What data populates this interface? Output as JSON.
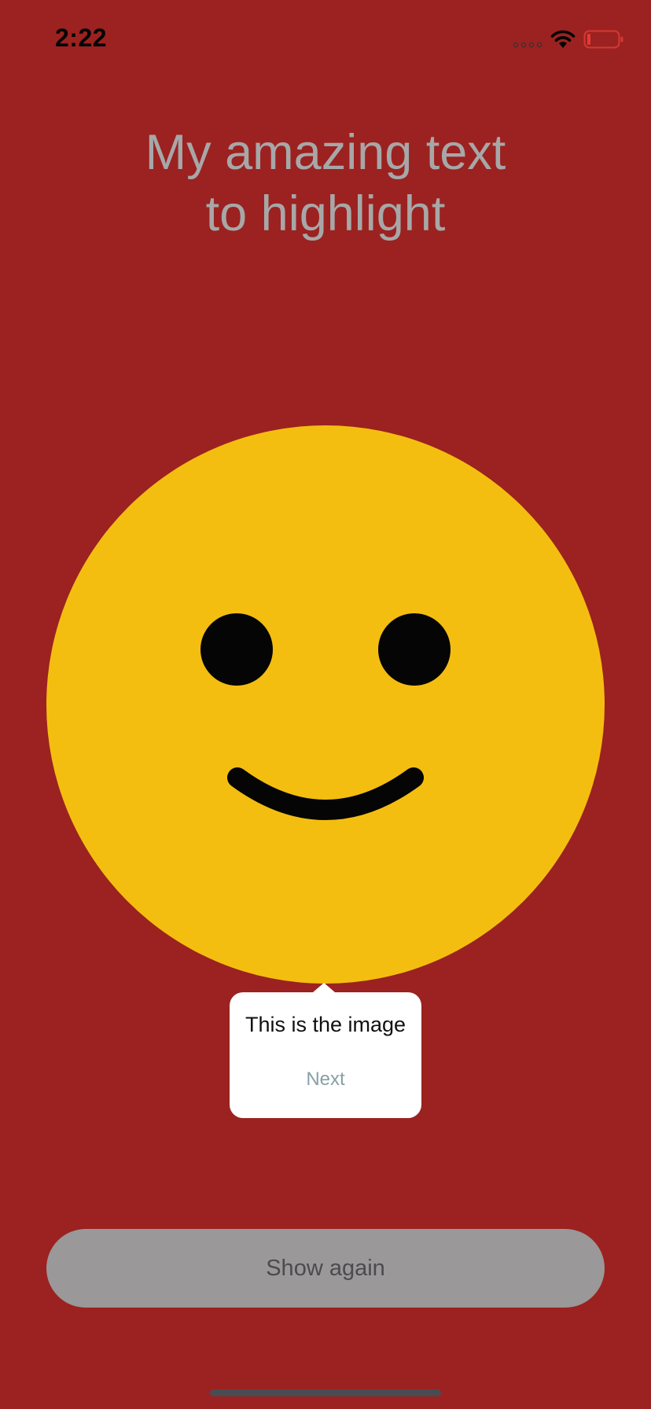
{
  "status_bar": {
    "time": "2:22",
    "icons": [
      "cellular-signal-icon",
      "wifi-icon",
      "battery-icon"
    ]
  },
  "main": {
    "headline_line1": "My amazing text",
    "headline_line2": "to highlight",
    "image_name": "smiley-face-icon"
  },
  "tooltip": {
    "message": "This is the image",
    "next_label": "Next"
  },
  "show_again_button": {
    "label": "Show again"
  },
  "colors": {
    "background": "#9b2220",
    "headline_text": "#a7a7a8",
    "face_fill": "#f4be10",
    "face_features": "#050505",
    "tooltip_background": "#ffffff",
    "tooltip_action": "#88a0a6",
    "button_background": "#9a9899",
    "button_text": "#4b4b4d"
  }
}
